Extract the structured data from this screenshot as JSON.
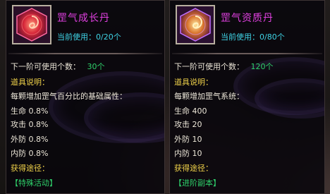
{
  "tooltips": [
    {
      "item_name": "罡气成长丹",
      "usage": "当前使用：0/20个",
      "next_tier_label": "下一阶可使用个数：",
      "next_tier_value": "30个",
      "desc_title": "道具说明：",
      "desc_text": "每颗增加罡气百分比的基础属性：",
      "stats": [
        "生命 0.8%",
        "攻击 0.8%",
        "外防 0.8%",
        "内防 0.8%"
      ],
      "source_title": "获得途径：",
      "source_link": "【特殊活动】",
      "icon": "red-swirl-gem-icon"
    },
    {
      "item_name": "罡气资质丹",
      "usage": "当前使用：0/80个",
      "next_tier_label": "下一阶可使用个数：",
      "next_tier_value": "120个",
      "desc_title": "道具说明：",
      "desc_text": "每颗增加罡气系统：",
      "stats": [
        "生命 400",
        "攻击 20",
        "外防 10",
        "内防 10"
      ],
      "source_title": "获得途径：",
      "source_link": "【进阶副本】",
      "icon": "gold-swirl-gem-icon"
    }
  ],
  "colors": {
    "item_name": "#e040e0",
    "usage": "#3fd4e6",
    "highlight_green": "#2fd16b",
    "section_yellow": "#f0d24a"
  }
}
